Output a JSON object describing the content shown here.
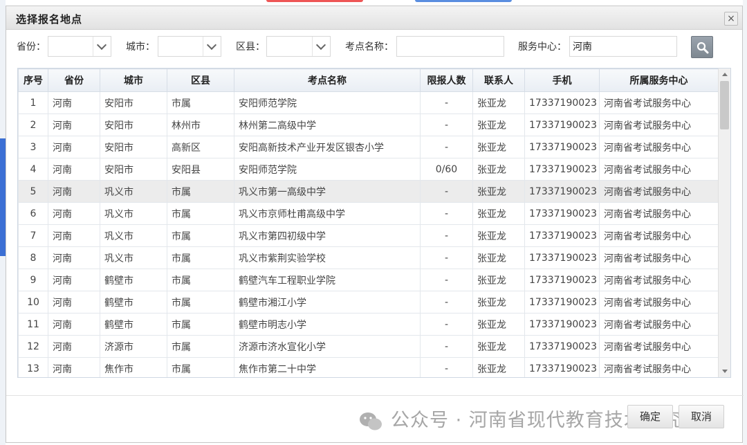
{
  "dialog": {
    "title": "选择报名地点",
    "close_glyph": "×"
  },
  "filters": {
    "province_label": "省份：",
    "city_label": "城市：",
    "district_label": "区县：",
    "exam_site_label": "考点名称：",
    "service_center_label": "服务中心：",
    "service_center_value": "河南",
    "search_icon": "search-icon"
  },
  "table": {
    "columns": [
      "序号",
      "省份",
      "城市",
      "区县",
      "考点名称",
      "限报人数",
      "联系人",
      "手机",
      "所属服务中心"
    ],
    "rows": [
      [
        "1",
        "河南",
        "安阳市",
        "市属",
        "安阳师范学院",
        "-",
        "张亚龙",
        "17337190023",
        "河南省考试服务中心"
      ],
      [
        "2",
        "河南",
        "安阳市",
        "林州市",
        "林州第二高级中学",
        "-",
        "张亚龙",
        "17337190023",
        "河南省考试服务中心"
      ],
      [
        "3",
        "河南",
        "安阳市",
        "高新区",
        "安阳高新技术产业开发区银杏小学",
        "-",
        "张亚龙",
        "17337190023",
        "河南省考试服务中心"
      ],
      [
        "4",
        "河南",
        "安阳市",
        "安阳县",
        "安阳师范学院",
        "0/60",
        "张亚龙",
        "17337190023",
        "河南省考试服务中心"
      ],
      [
        "5",
        "河南",
        "巩义市",
        "市属",
        "巩义市第一高级中学",
        "-",
        "张亚龙",
        "17337190023",
        "河南省考试服务中心"
      ],
      [
        "6",
        "河南",
        "巩义市",
        "市属",
        "巩义市京师杜甫高级中学",
        "-",
        "张亚龙",
        "17337190023",
        "河南省考试服务中心"
      ],
      [
        "7",
        "河南",
        "巩义市",
        "市属",
        "巩义市第四初级中学",
        "-",
        "张亚龙",
        "17337190023",
        "河南省考试服务中心"
      ],
      [
        "8",
        "河南",
        "巩义市",
        "市属",
        "巩义市紫荆实验学校",
        "-",
        "张亚龙",
        "17337190023",
        "河南省考试服务中心"
      ],
      [
        "9",
        "河南",
        "鹤壁市",
        "市属",
        "鹤壁汽车工程职业学院",
        "-",
        "张亚龙",
        "17337190023",
        "河南省考试服务中心"
      ],
      [
        "10",
        "河南",
        "鹤壁市",
        "市属",
        "鹤壁市湘江小学",
        "-",
        "张亚龙",
        "17337190023",
        "河南省考试服务中心"
      ],
      [
        "11",
        "河南",
        "鹤壁市",
        "市属",
        "鹤壁市明志小学",
        "-",
        "张亚龙",
        "17337190023",
        "河南省考试服务中心"
      ],
      [
        "12",
        "河南",
        "济源市",
        "市属",
        "济源市济水宣化小学",
        "-",
        "张亚龙",
        "17337190023",
        "河南省考试服务中心"
      ],
      [
        "13",
        "河南",
        "焦作市",
        "市属",
        "焦作市第二十中学",
        "-",
        "张亚龙",
        "17337190023",
        "河南省考试服务中心"
      ]
    ],
    "selected_row": 5
  },
  "footer": {
    "watermark": "公众号 · 河南省现代教育技术研究院",
    "confirm_label": "确定",
    "cancel_label": "取消"
  }
}
